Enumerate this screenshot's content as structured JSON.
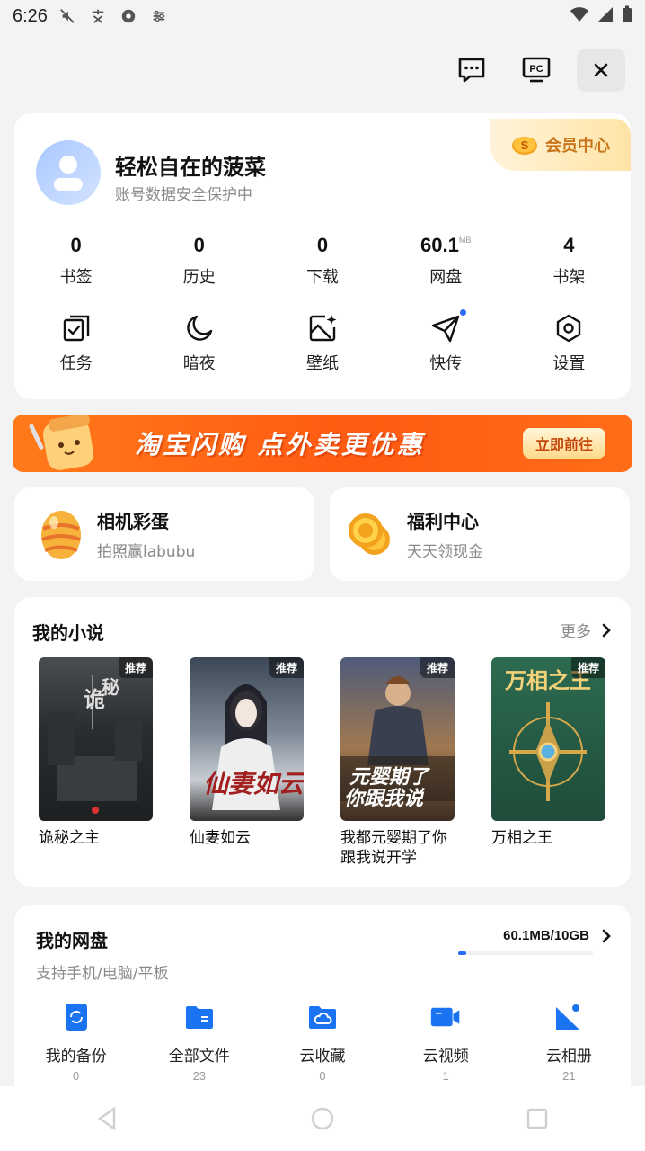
{
  "status_bar": {
    "time": "6:26"
  },
  "profile": {
    "name": "轻松自在的菠菜",
    "subtitle": "账号数据安全保护中",
    "vip_label": "会员中心"
  },
  "stats": [
    {
      "value": "0",
      "unit": "",
      "label": "书签"
    },
    {
      "value": "0",
      "unit": "",
      "label": "历史"
    },
    {
      "value": "0",
      "unit": "",
      "label": "下载"
    },
    {
      "value": "60.1",
      "unit": "MB",
      "label": "网盘"
    },
    {
      "value": "4",
      "unit": "",
      "label": "书架"
    }
  ],
  "tools": [
    {
      "label": "任务",
      "icon": "task-icon"
    },
    {
      "label": "暗夜",
      "icon": "moon-icon"
    },
    {
      "label": "壁纸",
      "icon": "wallpaper-icon"
    },
    {
      "label": "快传",
      "icon": "send-icon"
    },
    {
      "label": "设置",
      "icon": "settings-icon"
    }
  ],
  "banner": {
    "text": "淘宝闪购 点外卖更优惠",
    "button": "立即前往"
  },
  "mini_cards": [
    {
      "title": "相机彩蛋",
      "subtitle": "拍照赢labubu"
    },
    {
      "title": "福利中心",
      "subtitle": "天天领现金"
    }
  ],
  "novels": {
    "title": "我的小说",
    "more": "更多",
    "books": [
      {
        "name": "诡秘之主",
        "tag": "推荐"
      },
      {
        "name": "仙妻如云",
        "tag": "推荐"
      },
      {
        "name": "我都元婴期了你跟我说开学",
        "tag": "推荐"
      },
      {
        "name": "万相之王",
        "tag": "推荐"
      }
    ]
  },
  "disk": {
    "title": "我的网盘",
    "subtitle": "支持手机/电脑/平板",
    "usage": "60.1MB/10GB",
    "usage_fraction": 0.006,
    "items": [
      {
        "label": "我的备份",
        "count": "0"
      },
      {
        "label": "全部文件",
        "count": "23"
      },
      {
        "label": "云收藏",
        "count": "0"
      },
      {
        "label": "云视频",
        "count": "1"
      },
      {
        "label": "云相册",
        "count": "21"
      }
    ]
  },
  "colors": {
    "accent": "#2a6cf5",
    "vip": "#c8741a",
    "banner": "#ff5a12"
  }
}
